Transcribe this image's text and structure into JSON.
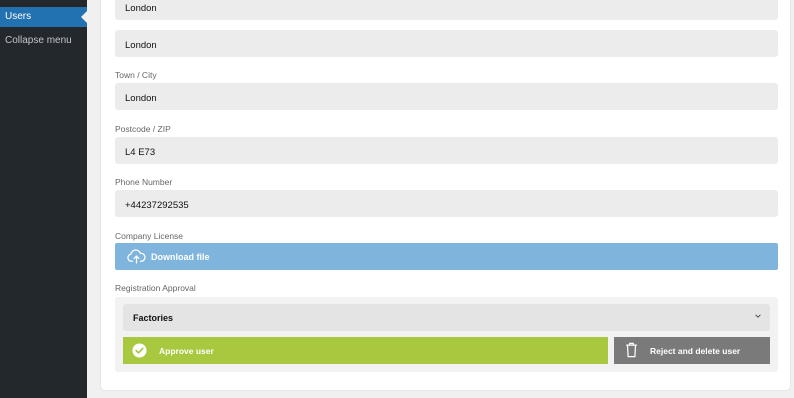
{
  "sidebar": {
    "active_item": "Users",
    "collapse_label": "Collapse menu"
  },
  "form": {
    "address_line1": "London",
    "address_line2": "London",
    "town_label": "Town / City",
    "town_value": "London",
    "postcode_label": "Postcode / ZIP",
    "postcode_value": "L4 E73",
    "phone_label": "Phone Number",
    "phone_value": "+44237292535",
    "license_label": "Company License",
    "download_label": "Download file",
    "approval_label": "Registration Approval",
    "approval_select": "Factories",
    "approve_label": "Approve user",
    "reject_label": "Reject and delete user"
  },
  "colors": {
    "sidebar_bg": "#23282d",
    "active_item": "#2271b1",
    "download_btn": "#7fb4dc",
    "approve_btn": "#a8c83f",
    "reject_btn": "#7a7a7a"
  },
  "icons": {
    "download": "cloud-upload-icon",
    "approve": "check-circle-icon",
    "reject": "trash-icon",
    "select": "chevron-down-icon"
  }
}
